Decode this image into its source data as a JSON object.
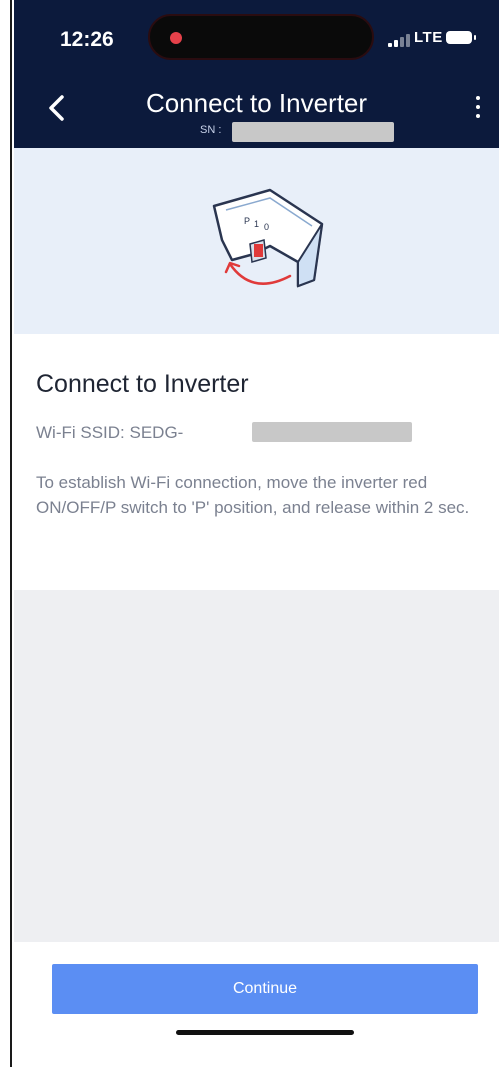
{
  "status_bar": {
    "time": "12:26",
    "network": "LTE"
  },
  "nav": {
    "title": "Connect to Inverter",
    "serial_label": "SN :"
  },
  "content": {
    "title": "Connect to Inverter",
    "ssid_label": "Wi-Fi SSID: SEDG-",
    "instructions": "To establish Wi-Fi connection, move the inverter red ON/OFF/P switch to 'P' position, and release within 2 sec."
  },
  "footer": {
    "continue_label": "Continue"
  },
  "illustration": {
    "switch_letters": [
      "P",
      "1",
      "0"
    ]
  },
  "colors": {
    "header_bg": "#0c1a3c",
    "accent_blue": "#5b8ef3",
    "hero_bg": "#e8eff9",
    "gray_area": "#eeeff2",
    "switch_red": "#e03a3a"
  }
}
